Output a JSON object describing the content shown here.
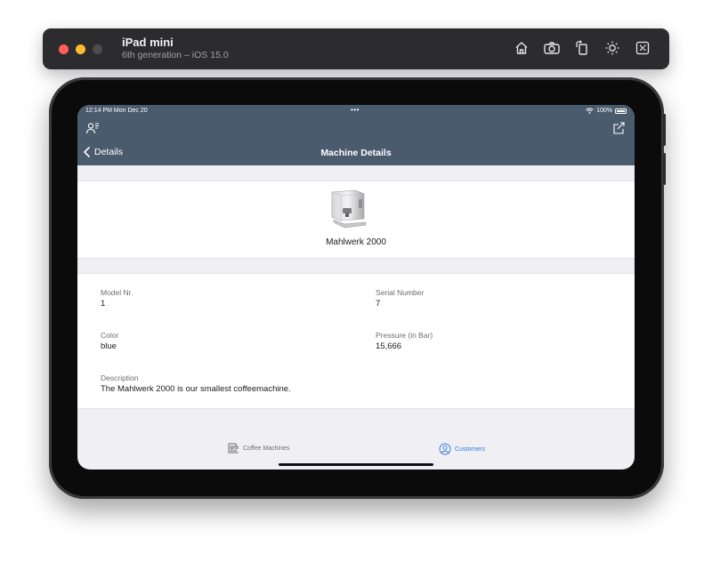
{
  "simulator": {
    "device_name": "iPad mini",
    "device_subtitle": "6th generation – iOS 15.0",
    "tools": [
      "home-icon",
      "screenshot-icon",
      "rotate-icon",
      "appearance-icon",
      "keyboard-icon"
    ]
  },
  "status_bar": {
    "time": "12:14 PM  Mon Dec 20",
    "dots": "•••",
    "battery": "100%"
  },
  "nav": {
    "back_label": "Details",
    "title": "Machine Details"
  },
  "machine": {
    "name": "Mahlwerk 2000"
  },
  "details": {
    "model_nr": {
      "label": "Model Nr.",
      "value": "1"
    },
    "serial_number": {
      "label": "Serial Number",
      "value": "7"
    },
    "color": {
      "label": "Color",
      "value": "blue"
    },
    "pressure": {
      "label": "Pressure (in Bar)",
      "value": "15,666"
    },
    "description": {
      "label": "Description",
      "value": "The Mahlwerk 2000 is our smallest coffeemachine."
    }
  },
  "tabbar": {
    "tabs": [
      {
        "label": "Coffee Machines",
        "selected": false
      },
      {
        "label": "Customers",
        "selected": true
      }
    ]
  },
  "colors": {
    "header": "#4a5b6e",
    "accent": "#3a7bd5",
    "background": "#efeff4"
  }
}
